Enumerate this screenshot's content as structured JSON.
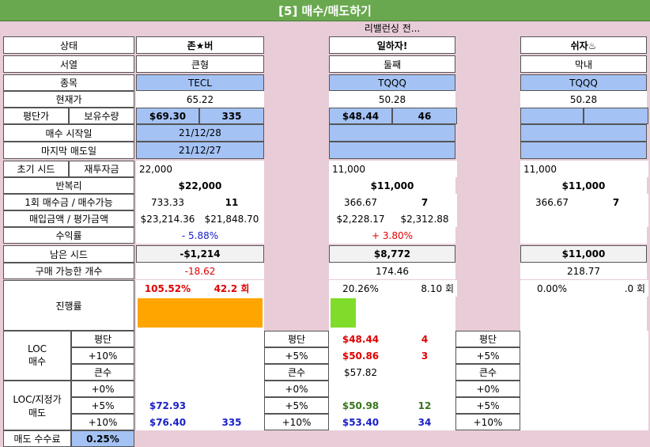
{
  "title": "[5] 매수/매도하기",
  "subtitle": "리밸런싱 전...",
  "labels": {
    "status": "상태",
    "order": "서열",
    "ticker": "종목",
    "price": "현재가",
    "avg": "평단가",
    "qty": "보유수량",
    "buy_start": "매수 시작일",
    "last_sell": "마지막 매도일",
    "seed": "초기 시드",
    "reinvest": "재투자금",
    "half": "반복리",
    "per_buy": "1회 매수금 / 매수가능",
    "amounts": "매입금액 / 평가금액",
    "profit": "수익률",
    "remain": "남은 시드",
    "buyable": "구매 가능한 개수",
    "progress": "진행률",
    "loc_buy": "LOC\n매수",
    "loc_sell": "LOC/지정가\n매도",
    "fee": "매도 수수료",
    "fee_value": "0.25%"
  },
  "players": [
    {
      "name": "존★버",
      "order": "큰형",
      "ticker": "TECL",
      "price": "65.22",
      "avg": "$69.30",
      "qty": "335",
      "buy_start": "21/12/28",
      "last_sell": "21/12/27",
      "seed": "22,000",
      "reinvest": "",
      "half": "$22,000",
      "per_buy": "733.33",
      "buy_count": "11",
      "buy_amt": "$23,214.36",
      "eval_amt": "$21,848.70",
      "profit": "- 5.88%",
      "remain": "-$1,214",
      "buyable": "-18.62",
      "prog_pct": "105.52%",
      "prog_cnt": "42.2 회",
      "prog_fill": 1.0552,
      "prog_color": "#ffa500",
      "buy_rows": [
        {
          "label": "평단",
          "price": "",
          "qty": ""
        },
        {
          "label": "+10%",
          "price": "",
          "qty": ""
        },
        {
          "label": "큰수",
          "price": "",
          "qty": ""
        }
      ],
      "sell_rows": [
        {
          "label": "+0%",
          "price": "",
          "qty": ""
        },
        {
          "label": "+5%",
          "price": "$72.93",
          "qty": ""
        },
        {
          "label": "+10%",
          "price": "$76.40",
          "qty": "335"
        }
      ]
    },
    {
      "name": "일하자!",
      "order": "둘째",
      "ticker": "TQQQ",
      "price": "50.28",
      "avg": "$48.44",
      "qty": "46",
      "buy_start": "",
      "last_sell": "",
      "seed": "11,000",
      "reinvest": "",
      "half": "$11,000",
      "per_buy": "366.67",
      "buy_count": "7",
      "buy_amt": "$2,228.17",
      "eval_amt": "$2,312.88",
      "profit": "+ 3.80%",
      "remain": "$8,772",
      "buyable": "174.46",
      "prog_pct": "20.26%",
      "prog_cnt": "8.10 회",
      "prog_fill": 0.2026,
      "prog_color": "#7fdc2a",
      "buy_rows": [
        {
          "label": "평단",
          "price": "$48.44",
          "qty": "4"
        },
        {
          "label": "+5%",
          "price": "$50.86",
          "qty": "3"
        },
        {
          "label": "큰수",
          "price": "$57.82",
          "qty": ""
        }
      ],
      "sell_rows": [
        {
          "label": "+0%",
          "price": "",
          "qty": ""
        },
        {
          "label": "+5%",
          "price": "$50.98",
          "qty": "12"
        },
        {
          "label": "+10%",
          "price": "$53.40",
          "qty": "34"
        }
      ]
    },
    {
      "name": "쉬자♨",
      "order": "막내",
      "ticker": "TQQQ",
      "price": "50.28",
      "avg": "",
      "qty": "",
      "buy_start": "",
      "last_sell": "",
      "seed": "11,000",
      "reinvest": "",
      "half": "$11,000",
      "per_buy": "366.67",
      "buy_count": "7",
      "buy_amt": "",
      "eval_amt": "",
      "profit": "",
      "remain": "$11,000",
      "buyable": "218.77",
      "prog_pct": "0.00%",
      "prog_cnt": ".0 회",
      "prog_fill": 0,
      "prog_color": "#7fdc2a",
      "buy_rows": [
        {
          "label": "평단",
          "price": "",
          "qty": ""
        },
        {
          "label": "+5%",
          "price": "",
          "qty": ""
        },
        {
          "label": "큰수",
          "price": "",
          "qty": ""
        }
      ],
      "sell_rows": [
        {
          "label": "+0%",
          "price": "",
          "qty": ""
        },
        {
          "label": "+5%",
          "price": "",
          "qty": ""
        },
        {
          "label": "+10%",
          "price": "",
          "qty": ""
        }
      ]
    }
  ],
  "loc_row_labels_buy": [
    "평단",
    "+10%",
    "큰수"
  ],
  "loc_row_labels_sell": [
    "+0%",
    "+5%",
    "+10%"
  ]
}
